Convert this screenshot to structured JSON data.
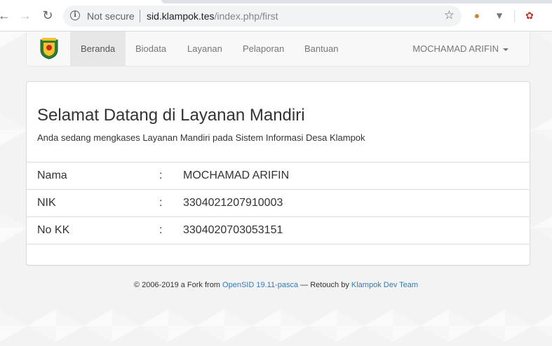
{
  "browser": {
    "security_label": "Not secure",
    "url_host": "sid.klampok.tes",
    "url_path": "/index.php/first"
  },
  "navbar": {
    "items": [
      {
        "label": "Beranda",
        "active": true
      },
      {
        "label": "Biodata",
        "active": false
      },
      {
        "label": "Layanan",
        "active": false
      },
      {
        "label": "Pelaporan",
        "active": false
      },
      {
        "label": "Bantuan",
        "active": false
      }
    ],
    "user_name": "MOCHAMAD ARIFIN"
  },
  "welcome": {
    "title": "Selamat Datang di Layanan Mandiri",
    "subtitle": "Anda sedang mengkases Layanan Mandiri pada Sistem Informasi Desa Klampok"
  },
  "info": [
    {
      "label": "Nama",
      "value": "MOCHAMAD ARIFIN"
    },
    {
      "label": "NIK",
      "value": "3304021207910003"
    },
    {
      "label": "No KK",
      "value": "3304020703053151"
    }
  ],
  "separator": ":",
  "footer": {
    "prefix": "© 2006-2019 a Fork from",
    "link1": "OpenSID 19.11-pasca",
    "middle": "— Retouch by",
    "link2": "Klampok Dev Team"
  }
}
